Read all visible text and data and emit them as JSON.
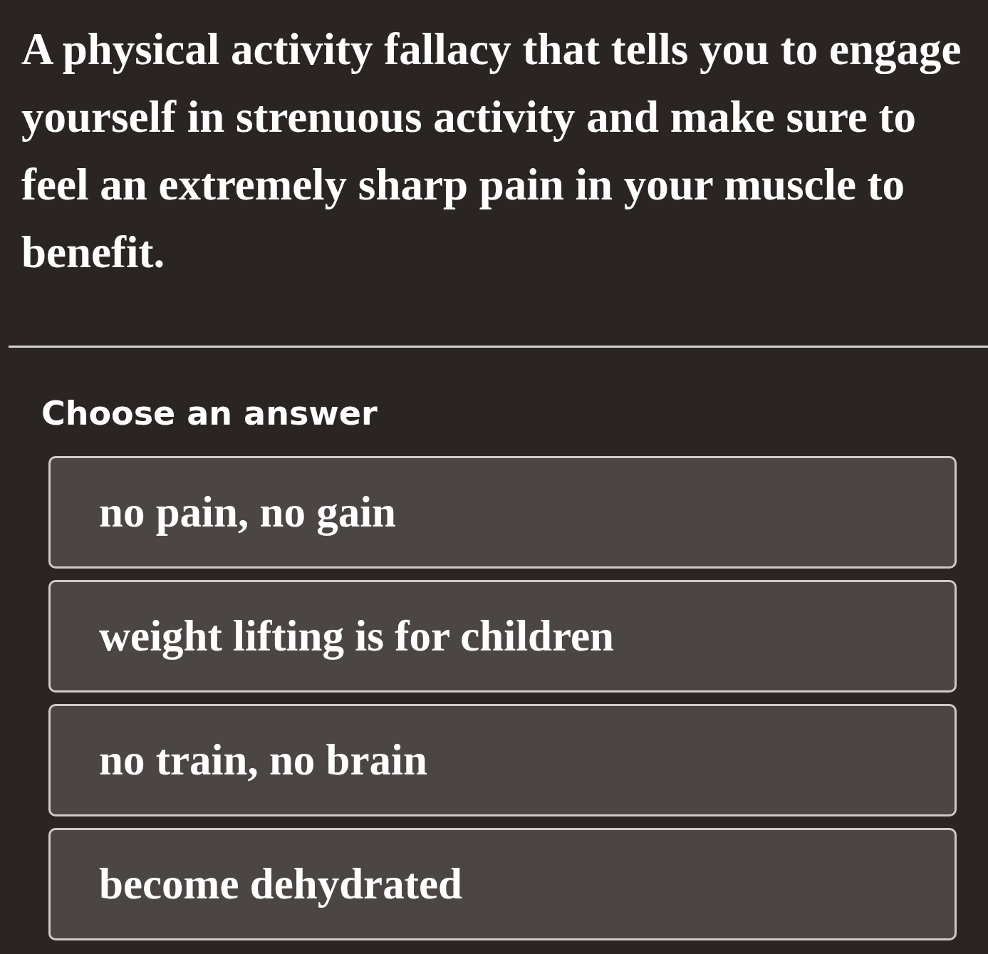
{
  "question": "A physical activity fallacy that tells you to engage yourself in strenuous activity and make sure to feel an extremely sharp pain in your muscle to benefit.",
  "prompt": "Choose an answer",
  "options": [
    {
      "label": "no pain, no gain",
      "selected": false
    },
    {
      "label": "weight lifting is for children",
      "selected": false
    },
    {
      "label": "no train, no brain",
      "selected": false
    },
    {
      "label": "become dehydrated",
      "selected": false
    }
  ]
}
